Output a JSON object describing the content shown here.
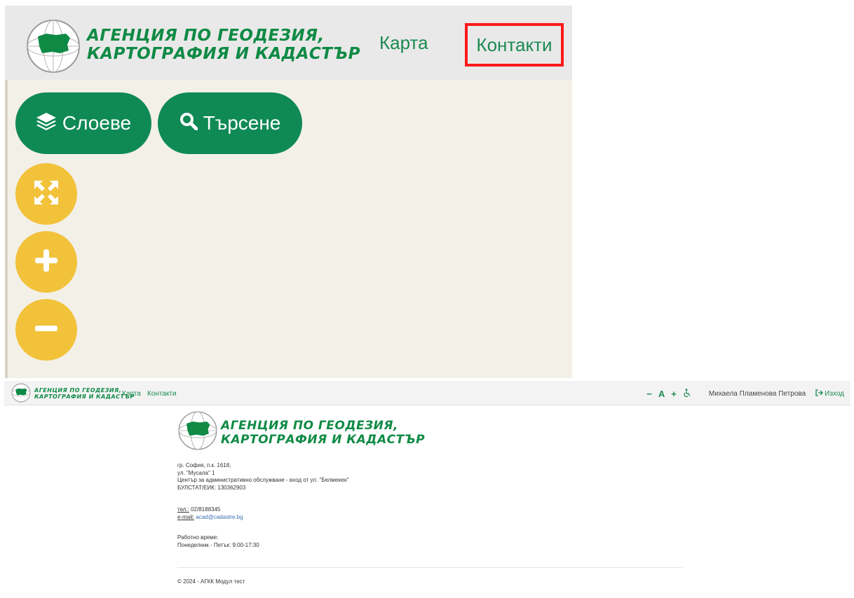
{
  "agency": {
    "brand_line1": "АГЕНЦИЯ ПО ГЕОДЕЗИЯ,",
    "brand_line2": "КАРТОГРАФИЯ И КАДАСТЪР"
  },
  "nav": {
    "map": "Карта",
    "contacts": "Контакти"
  },
  "zoom": {
    "layers_label": "Слоеве",
    "search_label": "Търсене",
    "highlight_color": "#ff1a1a"
  },
  "accessibility": {
    "decrease": "−",
    "letter": "A",
    "increase": "+"
  },
  "user": {
    "name": "Михаела Пламенова Петрова",
    "logout": "Изход"
  },
  "contact": {
    "address_line1": "гр. София, п.к. 1618,",
    "address_line2": "ул. \"Мусала\" 1",
    "address_line3": "Център за административно обслужване - вход от ул. \"Белмекен\"",
    "address_line4": "БУЛСТАТ/ЕИК: 130362903",
    "phone_label": "тел.:",
    "phone_value": "02/8188345",
    "email_label": "e-mail:",
    "email_value": "acad@cadastre.bg",
    "hours_label": "Работно време:",
    "hours_value": "Понеделник - Петък: 9:00-17:30"
  },
  "footer": {
    "text": "© 2024 - АГКК Модул тест"
  },
  "colors": {
    "brand_green": "#0f8a45",
    "button_green": "#0f8a55",
    "button_yellow": "#f2c23b"
  }
}
